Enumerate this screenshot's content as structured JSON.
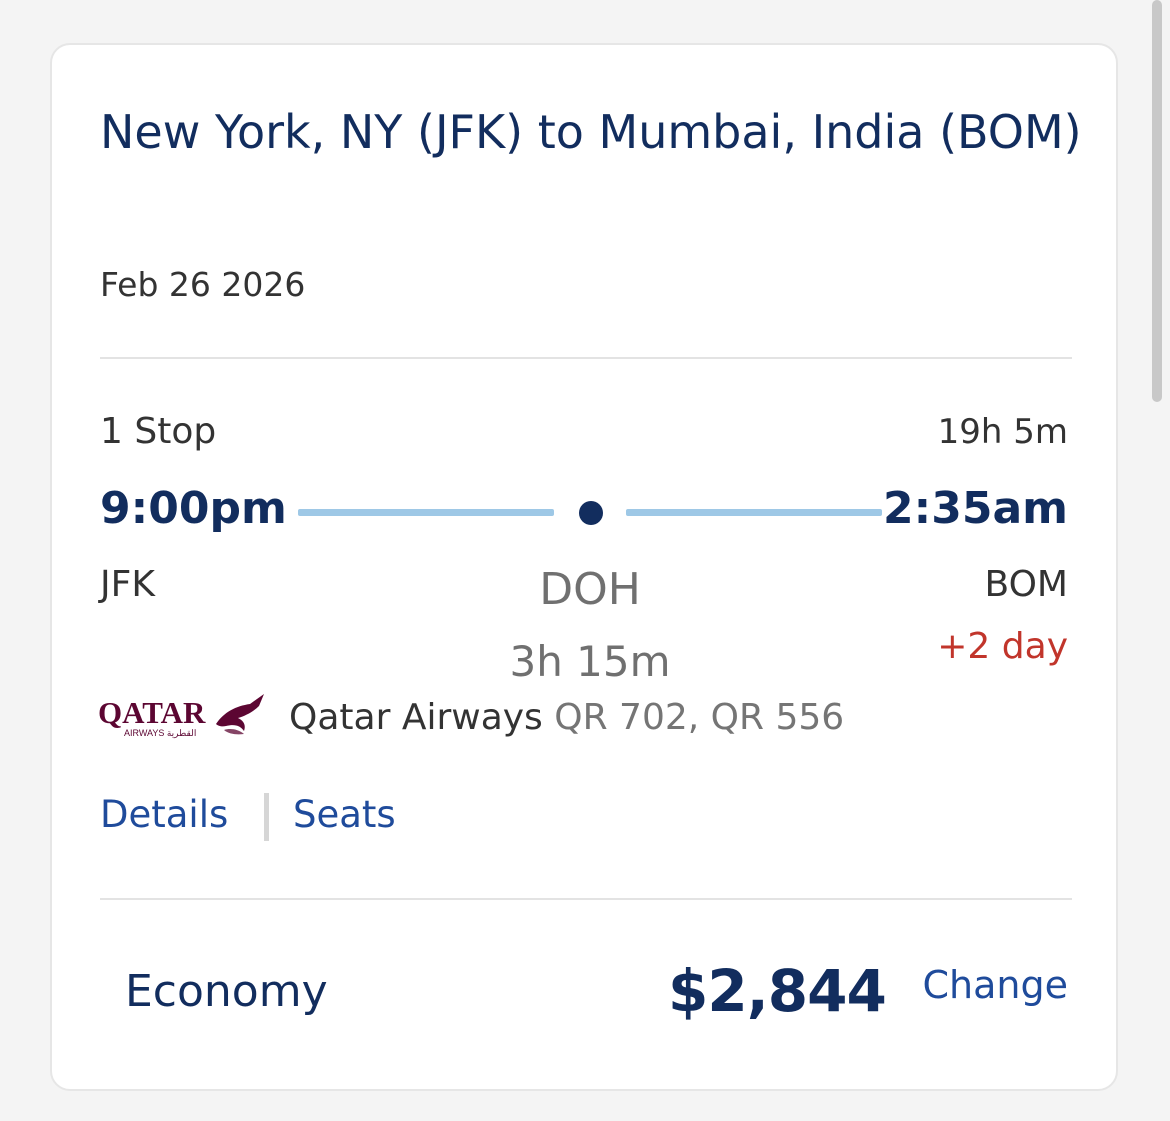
{
  "itinerary": {
    "title": "New York, NY (JFK) to Mumbai, India (BOM)",
    "date": "Feb 26 2026"
  },
  "flight": {
    "stops": "1 Stop",
    "duration": "19h 5m",
    "departure_time": "9:00pm",
    "arrival_time": "2:35am",
    "origin": "JFK",
    "destination": "BOM",
    "layover_airport": "DOH",
    "layover_duration": "3h 15m",
    "day_offset": "+2 day"
  },
  "airline": {
    "name": "Qatar Airways",
    "flight_numbers": "QR 702, QR 556",
    "logo_text": "QATAR",
    "logo_subtext": "AIRWAYS القطرية",
    "logo_color": "#5c0632",
    "logo_icon": "oryx-logo"
  },
  "actions": {
    "details_label": "Details",
    "seats_label": "Seats",
    "change_label": "Change"
  },
  "fare": {
    "cabin": "Economy",
    "price": "$2,844"
  },
  "colors": {
    "navy": "#122d5e",
    "link_blue": "#1f4b9b",
    "route_line": "#9ec8e6",
    "day_offset_red": "#c1352b"
  }
}
